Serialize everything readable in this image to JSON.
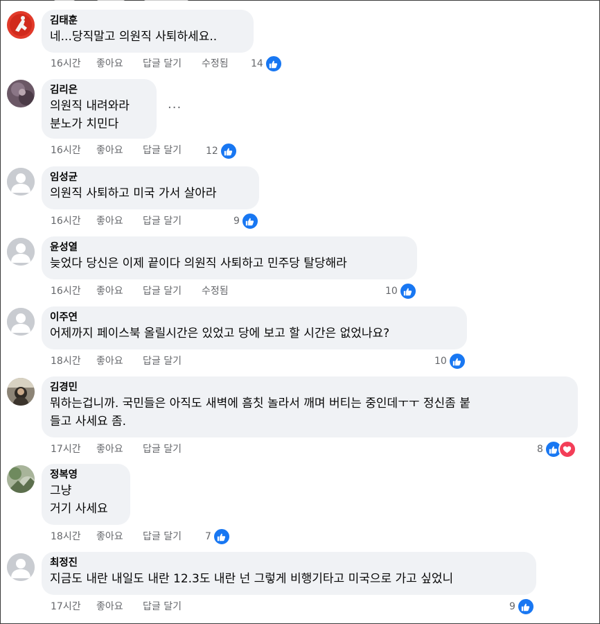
{
  "actions": {
    "like": "좋아요",
    "reply": "답글 달기",
    "edited": "수정됨"
  },
  "comments": [
    {
      "name": "김태훈",
      "lines": [
        "네...당직말고 의원직 사퇴하세요.."
      ],
      "time": "16시간",
      "edited": true,
      "reactions": "14",
      "avatar": "avatar-red-photo"
    },
    {
      "name": "김리은",
      "lines": [
        "의원직 내려와라",
        "분노가 치민다"
      ],
      "time": "16시간",
      "edited": false,
      "reactions": "12",
      "more": "···",
      "avatar": "avatar-purple-photo"
    },
    {
      "name": "임성균",
      "lines": [
        "의원직 사퇴하고 미국 가서 살아라"
      ],
      "time": "16시간",
      "edited": false,
      "reactions": "9",
      "avatar": "default-profile"
    },
    {
      "name": "윤성열",
      "lines": [
        "늦었다 당신은 이제 끝이다 의원직 사퇴하고 민주당 탈당해라"
      ],
      "time": "16시간",
      "edited": true,
      "reactions": "10",
      "avatar": "default-profile"
    },
    {
      "name": "이주연",
      "lines": [
        "어제까지 페이스북 올릴시간은 있었고 당에 보고 할 시간은 없었나요?"
      ],
      "time": "18시간",
      "edited": false,
      "reactions": "10",
      "avatar": "default-profile"
    },
    {
      "name": "김경민",
      "lines": [
        "뭐하는겁니까. 국민들은 아직도 새벽에 흠칫 놀라서 깨며 버티는 중인데ㅜㅜ 정신좀 붙",
        "들고 사세요 좀."
      ],
      "time": "17시간",
      "edited": false,
      "reactions": "8",
      "love": true,
      "avatar": "avatar-dark-photo"
    },
    {
      "name": "정복영",
      "lines": [
        "그냥",
        "거기 사세요"
      ],
      "time": "18시간",
      "edited": false,
      "reactions": "7",
      "avatar": "avatar-green-photo"
    },
    {
      "name": "최정진",
      "lines": [
        "지금도 내란 내일도 내란 12.3도 내란 넌 그렇게 비행기타고 미국으로 가고 싶었니"
      ],
      "time": "17시간",
      "edited": false,
      "reactions": "9",
      "avatar": "default-profile"
    }
  ],
  "colors": {
    "like": "#1877f2",
    "love": "#f33e58",
    "bubble": "#f0f2f5",
    "meta": "#65676b"
  }
}
